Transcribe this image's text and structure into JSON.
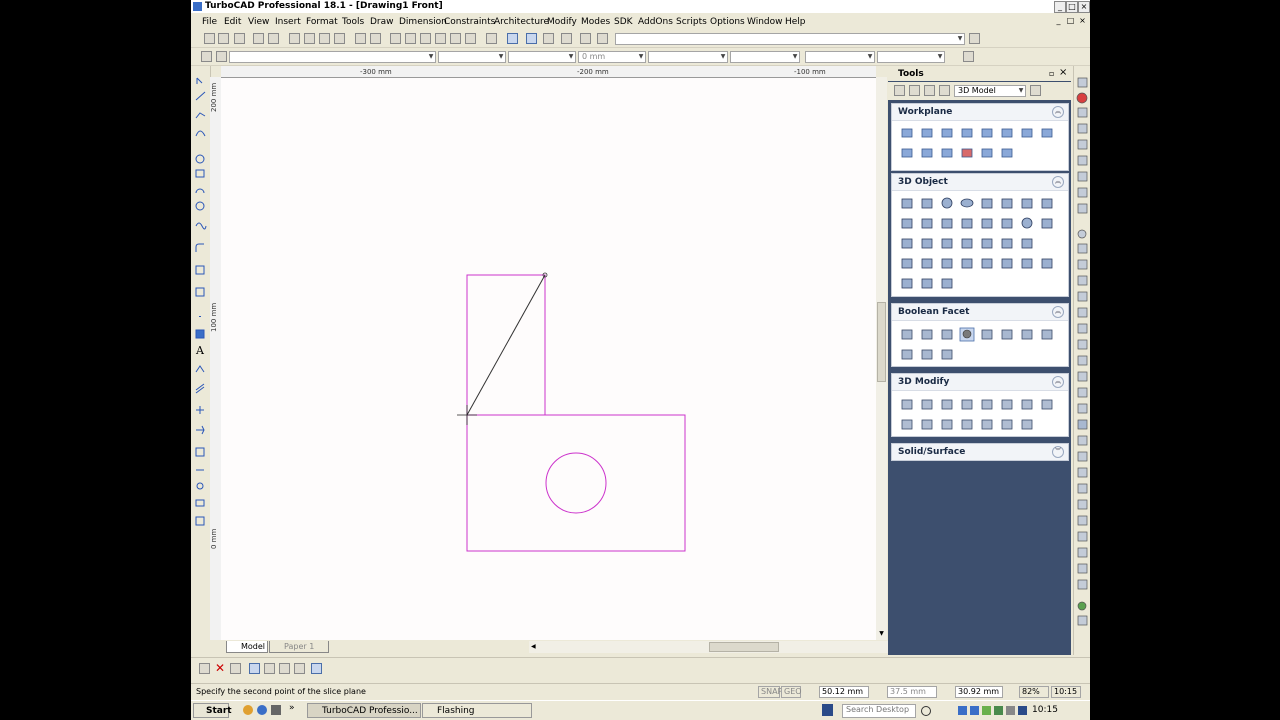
{
  "app": {
    "title": "TurboCAD Professional 18.1 - [Drawing1 Front]",
    "window_buttons": {
      "minimize": "_",
      "maximize": "□",
      "close": "×"
    }
  },
  "menu": [
    "File",
    "Edit",
    "View",
    "Insert",
    "Format",
    "Tools",
    "Draw",
    "Dimension",
    "Constraints",
    "Architecture",
    "Modify",
    "Modes",
    "SDK",
    "AddOns",
    "Scripts",
    "Options",
    "Window",
    "Help"
  ],
  "toolbar": {
    "coord_combo": "0 mm"
  },
  "rulers": {
    "horizontal": [
      "-300 mm",
      "-200 mm",
      "-100 mm"
    ],
    "vertical": [
      "200 mm",
      "100 mm",
      "0 mm"
    ]
  },
  "colors": {
    "geometry": "#cc33cc",
    "diagonal": "#333333",
    "tools_background": "#3d4f6e",
    "canvas": "#fefcfc"
  },
  "tabs": {
    "model": "Model",
    "paper": "Paper 1"
  },
  "tools_palette": {
    "title": "Tools",
    "mode_select": "3D Model",
    "panels": [
      {
        "title": "Workplane",
        "toggle": "︽"
      },
      {
        "title": "3D Object",
        "toggle": "︽"
      },
      {
        "title": "Boolean  Facet",
        "toggle": "︽"
      },
      {
        "title": "3D Modify",
        "toggle": "︽"
      },
      {
        "title": "Solid/Surface",
        "toggle": "︾"
      }
    ]
  },
  "status": {
    "prompt": "Specify the second point of the slice plane",
    "snap": "SNAP",
    "geo": "GEO",
    "x": "50.12 mm",
    "y": "37.5 mm",
    "z": "30.92 mm",
    "zoom": "82%",
    "time": "10:15"
  },
  "taskbar": {
    "start": "Start",
    "tasks": [
      "TurboCAD Professio...",
      "Flashing"
    ],
    "search_placeholder": "Search Desktop",
    "clock": "10:15"
  }
}
